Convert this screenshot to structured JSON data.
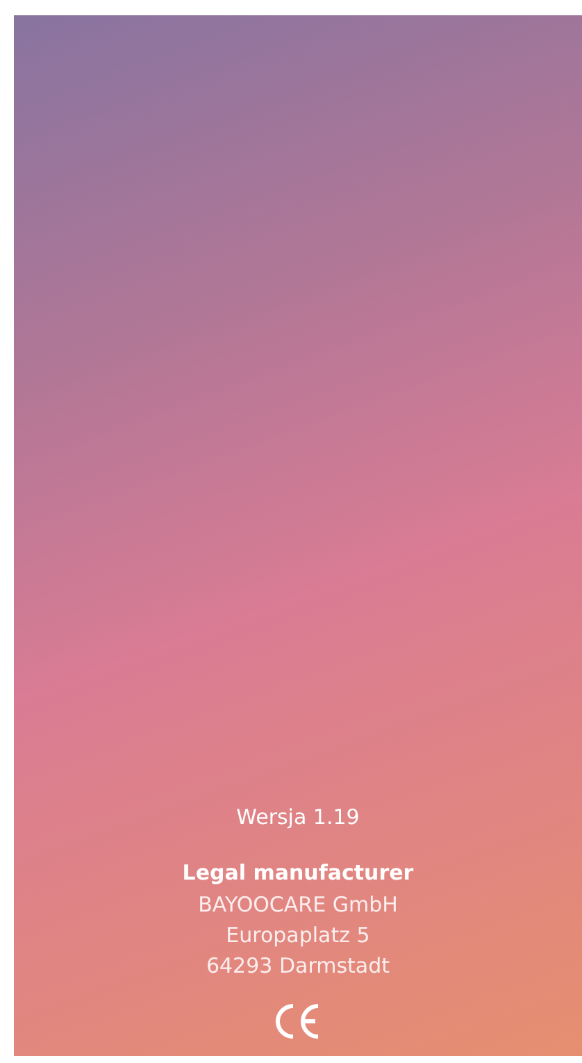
{
  "version": "Wersja 1.19",
  "manufacturer": {
    "heading": "Legal manufacturer",
    "lines": [
      "BAYOOCARE GmbH",
      "Europaplatz 5",
      "64293 Darmstadt"
    ]
  }
}
